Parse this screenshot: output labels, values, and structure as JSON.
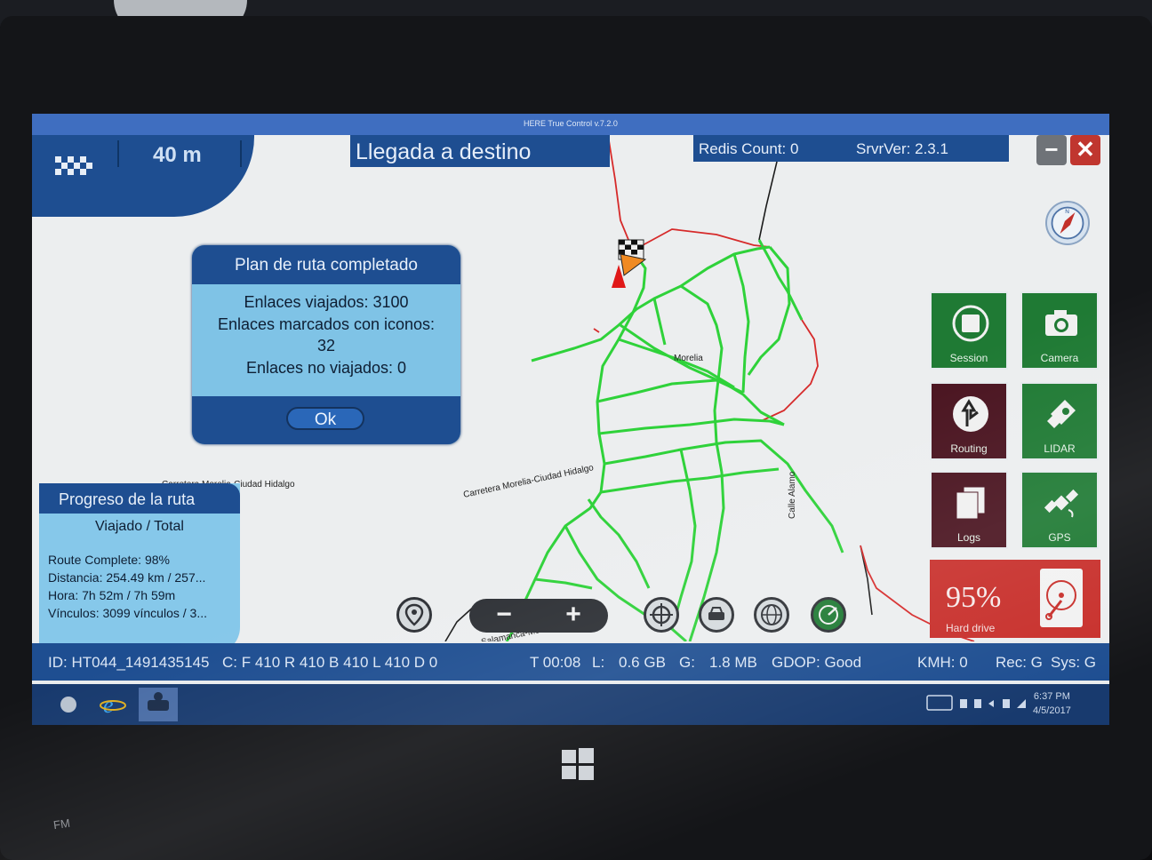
{
  "window": {
    "title": "HERE True Control v.7.2.0"
  },
  "header": {
    "distance": "40 m",
    "instruction": "Llegada a destino",
    "redis_count": "Redis Count: 0",
    "server_version": "SrvrVer: 2.3.1"
  },
  "dialog": {
    "title": "Plan de ruta completado",
    "lines": [
      "Enlaces viajados: 3100",
      "Enlaces marcados con iconos:",
      "32",
      "Enlaces no viajados: 0"
    ],
    "ok_label": "Ok"
  },
  "progress": {
    "title": "Progreso de la ruta",
    "subtitle": "Viajado / Total",
    "lines": [
      "Route Complete: 98%",
      "Distancia: 254.49 km / 257...",
      "Hora: 7h 52m / 7h 59m",
      "Vínculos: 3099 vínculos / 3..."
    ]
  },
  "map_labels": {
    "city": "Morelia",
    "road_main": "Carretera Morelia-Ciudad Hidalgo",
    "road_left": "Carretera Morelia-Ciudad Hidalgo",
    "street": "Calle Alamo",
    "road_bottom": "Salamanca-Morelia"
  },
  "tiles": [
    {
      "label": "Session",
      "icon": "stop-icon"
    },
    {
      "label": "Camera",
      "icon": "camera-icon"
    },
    {
      "label": "Routing",
      "icon": "routing-icon"
    },
    {
      "label": "LIDAR",
      "icon": "lidar-icon"
    },
    {
      "label": "Logs",
      "icon": "logs-icon"
    },
    {
      "label": "GPS",
      "icon": "gps-satellite-icon"
    }
  ],
  "hard_drive": {
    "percent": "95%",
    "label": "Hard drive"
  },
  "status": {
    "id": "ID: HT044_1491435145",
    "counters": "C: F 410 R 410 B 410 L 410 D 0",
    "time": "T 00:08",
    "l_label": "L:",
    "l_value": "0.6 GB",
    "g_label": "G:",
    "g_value": "1.8 MB",
    "gdop": "GDOP: Good",
    "kmh": "KMH: 0",
    "rec": "Rec: G",
    "sys": "Sys: G"
  },
  "taskbar": {
    "time": "6:37 PM",
    "date": "4/5/2017"
  },
  "zoom": {
    "minus": "−",
    "plus": "+"
  },
  "device": {
    "label": "FM"
  },
  "colors": {
    "accent": "#1e4e91",
    "tile_green": "#1f7a34",
    "hdd_red": "#c8302c",
    "route_green": "#2fd23a",
    "route_red": "#d62a2a"
  }
}
